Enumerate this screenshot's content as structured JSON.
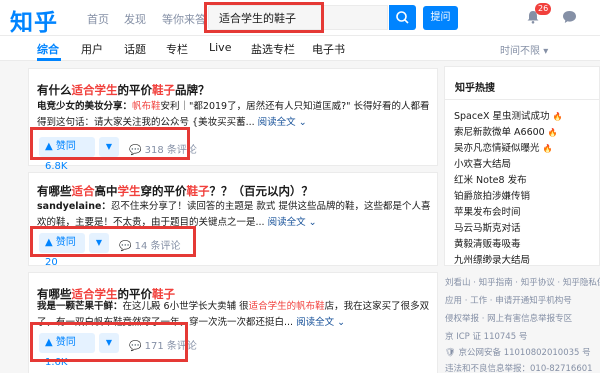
{
  "header": {
    "logo": "知乎",
    "nav": [
      "首页",
      "发现",
      "等你来答"
    ],
    "search_value": "适合学生的鞋子",
    "ask_label": "提问",
    "notification_count": "26"
  },
  "tabs": [
    "综合",
    "用户",
    "话题",
    "专栏",
    "Live",
    "盐选专栏",
    "电子书"
  ],
  "sort_label": "时间不限",
  "results": [
    {
      "title_pre": "有什么",
      "title_hl": "适合学生",
      "title_mid": "的平价",
      "title_hl2": "鞋子",
      "title_post": "品牌？",
      "author": "电竞少女的美妆分享：",
      "excerpt_a": "帆布鞋",
      "excerpt_b": "安利｜\"都2019了，居然还有人只知道匡威?\" 长得好看的人都看得到这句话：请大家关注我的公众号 {美妆买买蓄...",
      "more": "阅读全文",
      "upvote": "赞同 6.8K",
      "comments": "318 条评论"
    },
    {
      "title_pre": "有哪些",
      "title_hl": "适合",
      "title_mid": "高中",
      "title_hl2": "学生",
      "title_mid2": "穿的平价",
      "title_hl3": "鞋子",
      "title_post": "？？（百元以内）？",
      "author": "sandyelaine：",
      "excerpt_b": "忍不住来分享了！读回答的主题是 款式 提供这些品牌的鞋，这些都是个人喜欢的鞋，主要是！不太贵，由于题目的关键点之一是...",
      "more": "阅读全文",
      "upvote": "赞同 20",
      "comments": "14 条评论"
    },
    {
      "title_pre": "有哪些",
      "title_hl": "适合学生",
      "title_mid": "的平价",
      "title_hl2": "鞋子",
      "title_post": "",
      "author": "我是一颗芒果干鲜：",
      "excerpt_a_pre": "在这儿殿 6小世学长大卖辅 很",
      "excerpt_a": "适合学生的帆布鞋",
      "excerpt_b": "店，我在这家买了很多双了，有一双白帆布鞋竟然穿了一年，穿一次洗一次都还挺白...",
      "more": "阅读全文",
      "upvote": "赞同 1.6K",
      "comments": "171 条评论"
    }
  ],
  "sidebar": {
    "title": "知乎热搜",
    "hot": [
      {
        "text": "SpaceX 星虫测试成功",
        "fire": true
      },
      {
        "text": "索尼新款微单 A6600",
        "fire": true
      },
      {
        "text": "吴亦凡恋情疑似曝光",
        "fire": true
      },
      {
        "text": "小欢喜大结局",
        "fire": false
      },
      {
        "text": "红米 Note8 发布",
        "fire": false
      },
      {
        "text": "铂爵旅拍涉嫌传销",
        "fire": false
      },
      {
        "text": "苹果发布会时间",
        "fire": false
      },
      {
        "text": "马云马斯克对话",
        "fire": false
      },
      {
        "text": "黄毅清贩毒吸毒",
        "fire": false
      },
      {
        "text": "九州缥缈录大结局",
        "fire": false
      }
    ]
  },
  "footer": {
    "line1": "刘看山 · 知乎指南 · 知乎协议 · 知乎隐私保护",
    "line2": "应用 · 工作 · 申请开通知乎机构号",
    "line3": "侵权举报 · 网上有害信息举报专区",
    "line4": "京 ICP 证 110745 号",
    "line5": "京公网安备 11010802010035 号",
    "line6": "违法和不良信息举报：010-82716601"
  },
  "colors": {
    "brand": "#0084ff",
    "highlight": "#f1403c",
    "annotation_box": "#e53935"
  }
}
